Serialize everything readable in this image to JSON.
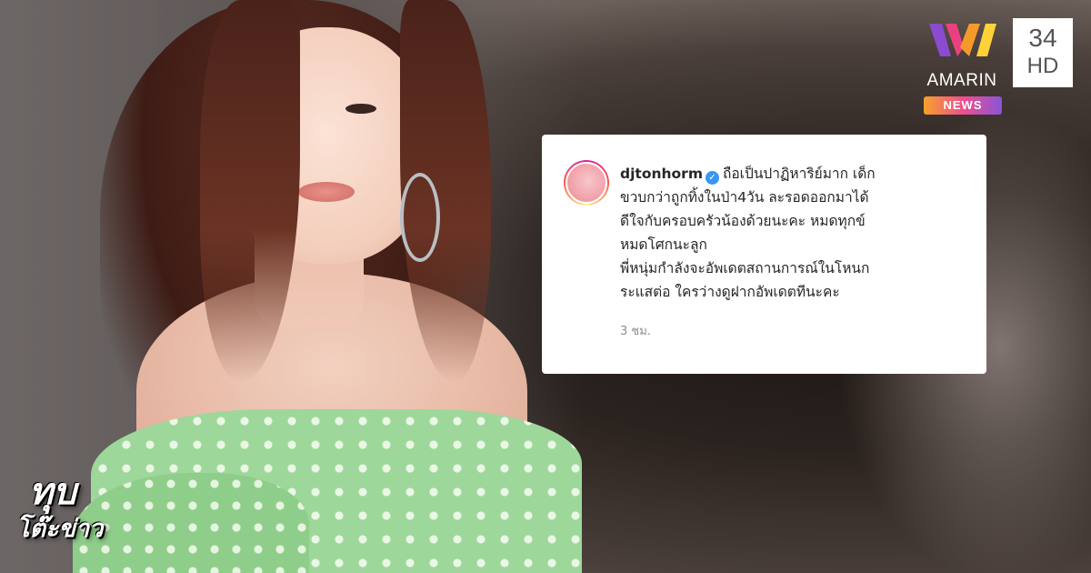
{
  "comment": {
    "username": "djtonhorm",
    "verified": true,
    "lines": [
      "ถือเป็นปาฏิหาริย์มาก เด็ก",
      "ขวบกว่าถูกทิ้งในป่า4วัน ละรอดออกมาได้",
      "ดีใจกับครอบครัวน้องด้วยนะคะ หมดทุกข์",
      "หมดโศกนะลูก",
      "พี่หนุ่มกำลังจะอัพเดตสถานการณ์ในโหนก",
      "ระแสต่อ ใครว่างดูฝากอัพเดตทีนะคะ"
    ],
    "timestamp": "3 ชม."
  },
  "brand": {
    "name": "AMARIN",
    "news_label": "NEWS",
    "channel_number": "34",
    "channel_hd": "HD"
  },
  "program": {
    "line1": "ทุบ",
    "line2": "โต๊ะข่าว"
  },
  "colors": {
    "verified_blue": "#3897f0",
    "dress_green": "#9ed79a"
  },
  "icons": {
    "verified": "verified-check-icon",
    "avatar": "avatar"
  }
}
